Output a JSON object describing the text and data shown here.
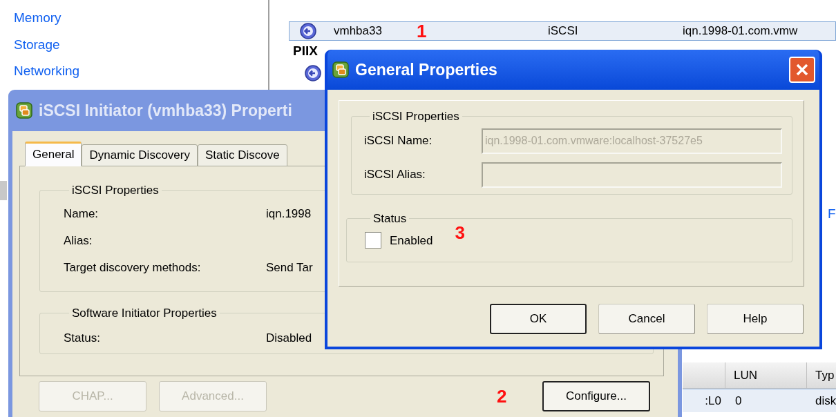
{
  "sidebar": {
    "links": [
      "Memory",
      "Storage",
      "Networking"
    ]
  },
  "adapters": {
    "rows": [
      {
        "name": "vmhba33",
        "marker": "1",
        "type": "iSCSI",
        "identifier": "iqn.1998-01.com.vmw",
        "selected": true
      }
    ],
    "group_heading": "PIIX"
  },
  "right_link": "F",
  "paths_table": {
    "columns": [
      "",
      "LUN",
      "Typ"
    ],
    "rows": [
      {
        "cells": [
          ":L0",
          "0",
          "disk"
        ],
        "selected": true
      }
    ]
  },
  "initiator_window": {
    "title": "iSCSI Initiator (vmhba33) Properti",
    "tabs": [
      {
        "label": "General",
        "selected": true
      },
      {
        "label": "Dynamic Discovery",
        "selected": false
      },
      {
        "label": "Static Discove",
        "selected": false
      }
    ],
    "iscsi_group": {
      "title": "iSCSI Properties",
      "rows": [
        {
          "label": "Name:",
          "value": "iqn.1998"
        },
        {
          "label": "Alias:"
        },
        {
          "label": "Target discovery methods:",
          "value": "Send Tar"
        }
      ]
    },
    "software_group": {
      "title": "Software Initiator Properties",
      "rows": [
        {
          "label": "Status:",
          "value": "Disabled"
        }
      ]
    },
    "buttons": [
      {
        "label": "CHAP...",
        "disabled": true
      },
      {
        "label": "Advanced...",
        "disabled": true
      },
      {
        "label": "Configure...",
        "disabled": false
      }
    ],
    "marker": "2"
  },
  "dialog": {
    "title": "General Properties",
    "iscsi_group": {
      "title": "iSCSI Properties",
      "fields": [
        {
          "label": "iSCSI Name:",
          "value": "iqn.1998-01.com.vmware:localhost-37527e5",
          "disabled": true
        },
        {
          "label": "iSCSI Alias:",
          "disabled": true
        }
      ]
    },
    "status_group": {
      "title": "Status",
      "checkbox": {
        "label": "Enabled",
        "checked": false
      }
    },
    "marker": "3",
    "buttons": [
      {
        "label": "OK",
        "default": true
      },
      {
        "label": "Cancel",
        "default": false
      },
      {
        "label": "Help",
        "default": false
      }
    ]
  }
}
